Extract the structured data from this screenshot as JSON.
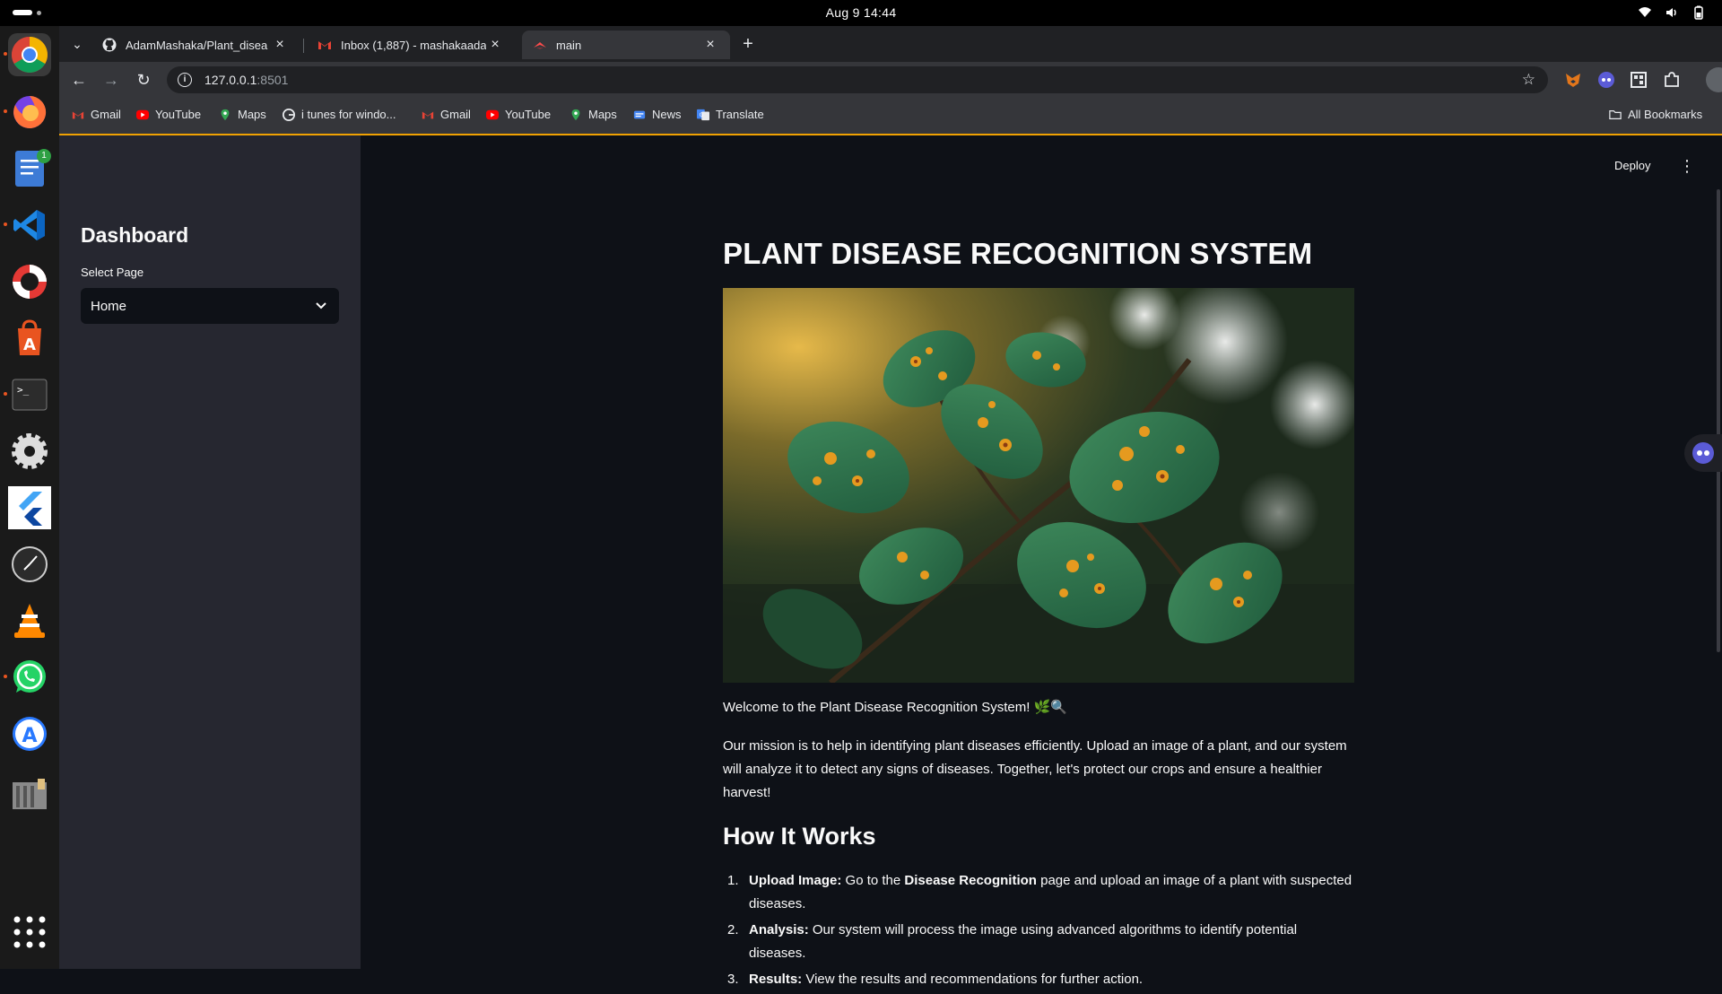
{
  "system": {
    "clock": "Aug 9  14:44"
  },
  "dock": {
    "items": [
      "chrome-icon",
      "firefox-icon",
      "text-editor-icon",
      "vscode-icon",
      "help-icon",
      "app-center-icon",
      "terminal-icon",
      "settings-icon",
      "flutter-icon",
      "clock-icon",
      "vlc-icon",
      "whatsapp-icon",
      "software-store-icon",
      "archive-icon",
      "app-grid-icon"
    ],
    "editor_badge": "1"
  },
  "browser": {
    "tabs": [
      {
        "title": "AdamMashaka/Plant_disea",
        "icon": "github-icon"
      },
      {
        "title": "Inbox (1,887) - mashakaada",
        "icon": "gmail-icon"
      },
      {
        "title": "main",
        "icon": "streamlit-icon",
        "active": true
      }
    ],
    "url_host": "127.0.0.1",
    "url_port": ":8501",
    "bookmarks": [
      {
        "label": "Gmail",
        "icon": "gmail-icon"
      },
      {
        "label": "YouTube",
        "icon": "youtube-icon"
      },
      {
        "label": "Maps",
        "icon": "maps-icon"
      },
      {
        "label": "i tunes for windo...",
        "icon": "google-icon"
      },
      {
        "label": "Gmail",
        "icon": "gmail-icon"
      },
      {
        "label": "YouTube",
        "icon": "youtube-icon"
      },
      {
        "label": "Maps",
        "icon": "maps-icon"
      },
      {
        "label": "News",
        "icon": "news-icon"
      },
      {
        "label": "Translate",
        "icon": "translate-icon"
      }
    ],
    "all_bookmarks": "All Bookmarks"
  },
  "sidebar": {
    "title": "Dashboard",
    "select_label": "Select Page",
    "select_value": "Home"
  },
  "header": {
    "deploy": "Deploy"
  },
  "main": {
    "title": "PLANT DISEASE RECOGNITION SYSTEM",
    "welcome": "Welcome to the Plant Disease Recognition System! 🌿🔍",
    "mission": "Our mission is to help in identifying plant diseases efficiently. Upload an image of a plant, and our system will analyze it to detect any signs of diseases. Together, let's protect our crops and ensure a healthier harvest!",
    "how_title": "How It Works",
    "steps": [
      {
        "num": "1.",
        "bold": "Upload Image:",
        "text_a": " Go to the ",
        "bold2": "Disease Recognition",
        "text_b": " page and upload an image of a plant with suspected diseases."
      },
      {
        "num": "2.",
        "bold": "Analysis:",
        "text_a": " Our system will process the image using advanced algorithms to identify potential diseases."
      },
      {
        "num": "3.",
        "bold": "Results:",
        "text_a": " View the results and recommendations for further action."
      }
    ]
  },
  "colors": {
    "app_bg": "#0e1117",
    "sidebar_bg": "#262730",
    "text": "#fafafa",
    "bookmark_accent": "#f0a202"
  }
}
